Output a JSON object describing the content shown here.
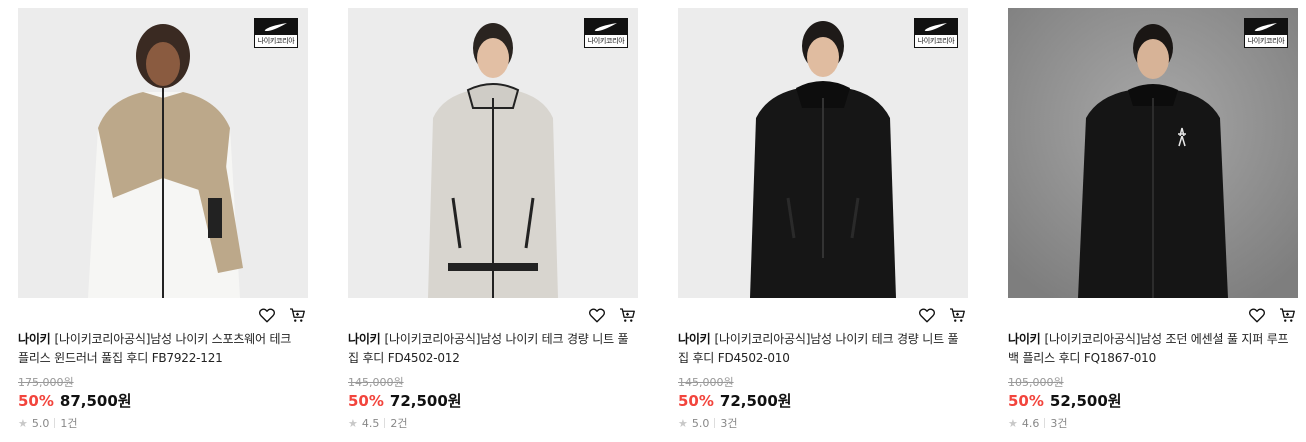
{
  "products": [
    {
      "brand": "나이키",
      "name": "[나이키코리아공식]남성 나이키 스포츠웨어 테크 플리스 윈드러너 풀집 후디 FB7922-121",
      "original_price": "175,000원",
      "discount": "50%",
      "price": "87,500원",
      "rating": "5.0",
      "reviews": "1건",
      "badge_text": "나이키코리아"
    },
    {
      "brand": "나이키",
      "name": "[나이키코리아공식]남성 나이키 테크 경량 니트 풀집 후디 FD4502-012",
      "original_price": "145,000원",
      "discount": "50%",
      "price": "72,500원",
      "rating": "4.5",
      "reviews": "2건",
      "badge_text": "나이키코리아"
    },
    {
      "brand": "나이키",
      "name": "[나이키코리아공식]남성 나이키 테크 경량 니트 풀집 후디 FD4502-010",
      "original_price": "145,000원",
      "discount": "50%",
      "price": "72,500원",
      "rating": "5.0",
      "reviews": "3건",
      "badge_text": "나이키코리아"
    },
    {
      "brand": "나이키",
      "name": "[나이키코리아공식]남성 조던 에센셜 풀 지퍼 루프백 플리스 후디 FQ1867-010",
      "original_price": "105,000원",
      "discount": "50%",
      "price": "52,500원",
      "rating": "4.6",
      "reviews": "3건",
      "badge_text": "나이키코리아"
    }
  ],
  "icons": {
    "wishlist": "heart-icon",
    "cart": "cart-icon",
    "rating": "star-icon",
    "badge_logo": "swoosh-icon"
  },
  "colors": {
    "discount": "#f2453d",
    "photo_bg_light": "#ececec",
    "photo_bg_dark": "#8f8f8f"
  }
}
